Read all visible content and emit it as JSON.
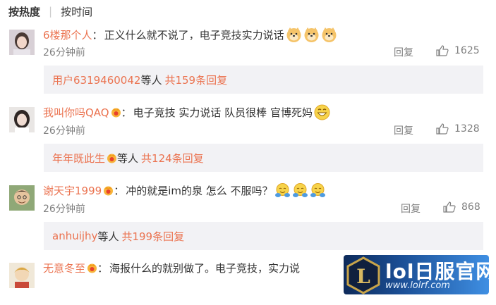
{
  "sort": {
    "active": "按热度",
    "other": "按时间"
  },
  "comments": [
    {
      "user": "6楼那个人",
      "sep": "：",
      "text": "正义什么就不说了，电子竞技实力说话",
      "emoji": [
        "doge-emoji",
        "doge-emoji",
        "doge-emoji"
      ],
      "time": "26分钟前",
      "reply": "回复",
      "likes": "1625",
      "sub": {
        "user": "用户6319460042",
        "mid": " 等人 ",
        "total": "共159条回复"
      }
    },
    {
      "user": "我叫你吗QAQ",
      "sep": "：",
      "text": "电子竞技 实力说话 队员很棒 官博死妈",
      "emoji": [
        "grin-emoji"
      ],
      "time": "26分钟前",
      "reply": "回复",
      "likes": "1328",
      "sub": {
        "user": "年年既此生",
        "mid": " 等人 ",
        "total": "共124条回复"
      }
    },
    {
      "user": "谢天宇1999",
      "sep": "：",
      "text": "冲的就是im的泉 怎么 不服吗？",
      "emoji": [
        "hug-emoji",
        "hug-emoji",
        "hug-emoji"
      ],
      "time": "26分钟前",
      "reply": "回复",
      "likes": "868",
      "sub": {
        "user": "anhuijhy",
        "mid": "等人 ",
        "total": "共199条回复"
      }
    },
    {
      "user": "无意冬至",
      "sep": "：",
      "text": "海报什么的就别做了。电子竞技，实力说"
    }
  ],
  "watermark": {
    "title": "lol日服官网",
    "url": "www.lolrf.com",
    "logo_letter": "L"
  },
  "colors": {
    "username": "#eb7350",
    "meta": "#808080",
    "subbox_bg": "#f2f2f5"
  }
}
